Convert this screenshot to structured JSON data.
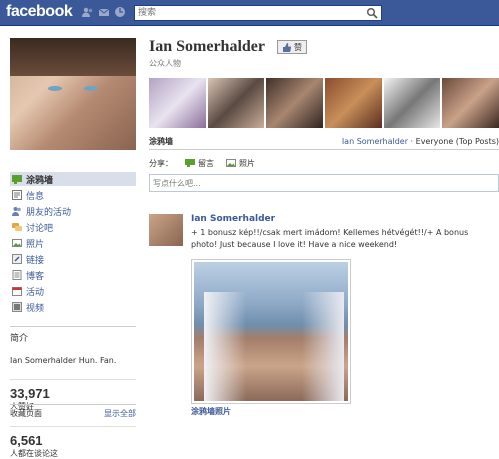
{
  "app": {
    "logo": "facebook"
  },
  "search": {
    "placeholder": "搜索"
  },
  "profile": {
    "name": "Ian Somerhalder",
    "like_label": "赞",
    "category": "公众人物"
  },
  "sidebar": {
    "items": [
      {
        "label": "涂鸦墙",
        "icon": "wall-icon",
        "active": true
      },
      {
        "label": "信息",
        "icon": "info-icon"
      },
      {
        "label": "朋友的活动",
        "icon": "friends-icon"
      },
      {
        "label": "讨论吧",
        "icon": "discussion-icon"
      },
      {
        "label": "照片",
        "icon": "photo-icon"
      },
      {
        "label": "链接",
        "icon": "link-icon"
      },
      {
        "label": "博客",
        "icon": "notes-icon"
      },
      {
        "label": "活动",
        "icon": "event-icon"
      },
      {
        "label": "视频",
        "icon": "video-icon"
      }
    ],
    "intro_title": "简介",
    "intro_text": "Ian Somerhalder Hun. Fan.",
    "likes_count": "33,971",
    "likes_label": "人赞好",
    "talking_count": "6,561",
    "talking_label": "人都在谈论这",
    "footer_left": "收藏页面",
    "footer_right": "显示全部"
  },
  "tabs": {
    "current": "涂鸦墙",
    "filter_name": "Ian Somerhalder",
    "filter_rest": " · Everyone (Top Posts)"
  },
  "share": {
    "label": "分享：",
    "status": "留言",
    "photo": "照片",
    "placeholder": "写点什么吧..."
  },
  "post": {
    "author": "Ian Somerhalder",
    "text": "+ 1 bonusz kép!!/csak mert imádom! Kellemes hétvégét!!/+ A bonus photo! Just because I love it! Have a nice weekend!",
    "caption": "涂鸦墙照片"
  },
  "colors": {
    "brand": "#3b5998",
    "nav_active": "#d8dfea"
  }
}
